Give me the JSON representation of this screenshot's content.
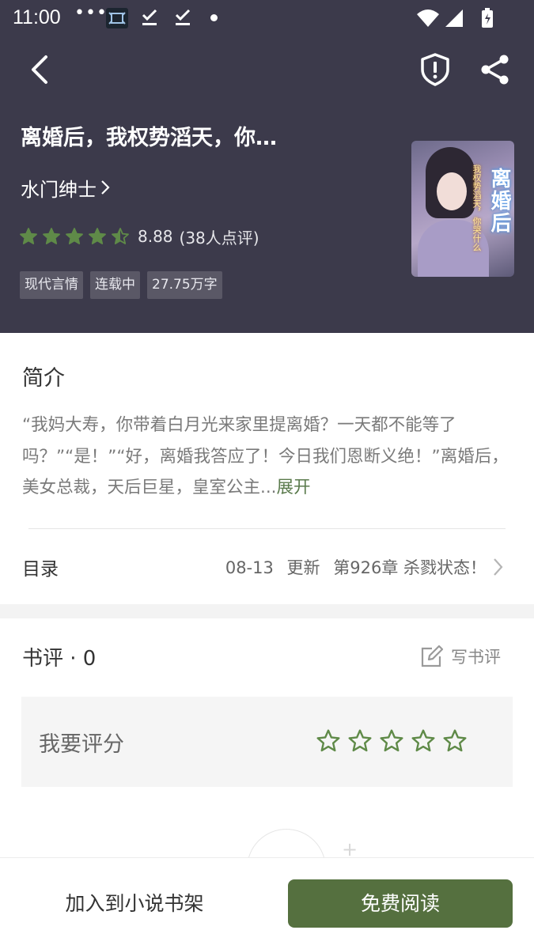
{
  "status_bar": {
    "time": "11:00",
    "dots": "•••"
  },
  "book": {
    "title": "离婚后，我权势滔天，你…",
    "author": "水门绅士",
    "rating_score": "8.88",
    "rating_count": "(38人点评)",
    "rating_stars": 4.5,
    "tags": [
      "现代言情",
      "连载中",
      "27.75万字"
    ],
    "cover_title": "离婚后",
    "cover_subtitle": "我权势滔天，你哭什么"
  },
  "intro": {
    "heading": "简介",
    "text": "“我妈大寿，你带着白月光来家里提离婚？一天都不能等了吗？”“是！”“好，离婚我答应了！今日我们恩断义绝！”离婚后，美女总裁，天后巨星，皇室公主...",
    "more_label": "展开"
  },
  "catalog": {
    "label": "目录",
    "date": "08-13",
    "update_label": "更新",
    "latest_chapter": "第926章 杀戮状态！"
  },
  "reviews": {
    "heading": "书评 · 0",
    "write_label": "写书评",
    "rate_label": "我要评分",
    "rate_star_count": 5
  },
  "bottom": {
    "add_shelf_label": "加入到小说书架",
    "read_label": "免费阅读"
  },
  "colors": {
    "header_bg": "#3c3a4b",
    "accent_green": "#55703f",
    "star_green": "#5f8a48"
  },
  "icons": [
    "back-icon",
    "report-shield-icon",
    "share-icon",
    "chevron-right-icon",
    "star-icon",
    "edit-icon",
    "wifi-icon",
    "signal-icon",
    "battery-icon"
  ]
}
